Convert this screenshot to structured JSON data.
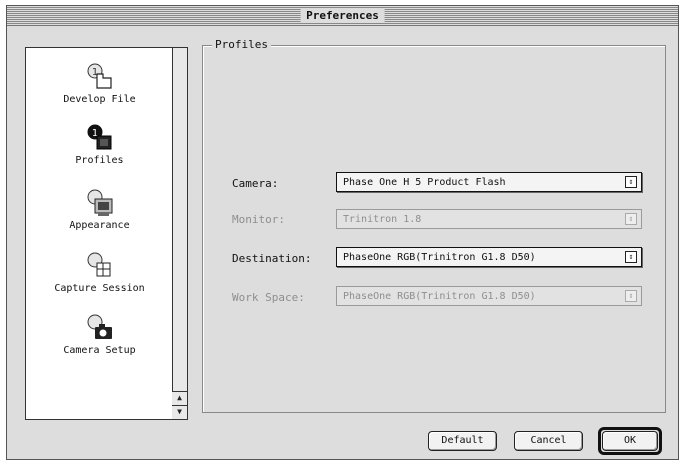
{
  "window": {
    "title": "Preferences"
  },
  "sidebar": {
    "items": [
      {
        "label": "Develop File",
        "icon": "develop-file-icon"
      },
      {
        "label": "Profiles",
        "icon": "profiles-icon",
        "selected": true
      },
      {
        "label": "Appearance",
        "icon": "appearance-icon"
      },
      {
        "label": "Capture Session",
        "icon": "capture-session-icon"
      },
      {
        "label": "Camera Setup",
        "icon": "camera-setup-icon"
      }
    ]
  },
  "profiles": {
    "legend": "Profiles",
    "camera": {
      "label": "Camera:",
      "value": "Phase One H 5  Product Flash",
      "enabled": true
    },
    "monitor": {
      "label": "Monitor:",
      "value": "Trinitron 1.8",
      "enabled": false
    },
    "destination": {
      "label": "Destination:",
      "value": "PhaseOne RGB(Trinitron G1.8 D50)",
      "enabled": true
    },
    "workspace": {
      "label": "Work Space:",
      "value": "PhaseOne RGB(Trinitron G1.8 D50)",
      "enabled": false
    }
  },
  "buttons": {
    "default": "Default",
    "cancel": "Cancel",
    "ok": "OK"
  },
  "colors": {
    "window_bg": "#dddddd",
    "disabled_text": "#8e8e8e"
  }
}
